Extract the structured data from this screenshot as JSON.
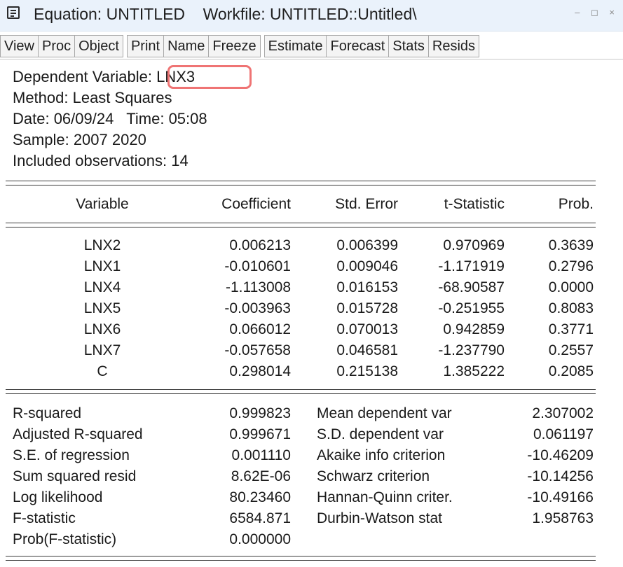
{
  "window": {
    "title": "Equation: UNTITLED    Workfile: UNTITLED::Untitled\\",
    "controls": "– ◻ ×"
  },
  "toolbar": {
    "groups": [
      [
        "View",
        "Proc",
        "Object"
      ],
      [
        "Print",
        "Name",
        "Freeze"
      ],
      [
        "Estimate",
        "Forecast",
        "Stats",
        "Resids"
      ]
    ]
  },
  "header": {
    "dependent_variable": "Dependent Variable: LNX3",
    "method": "Method: Least Squares",
    "date_time": "Date: 06/09/24   Time: 05:08",
    "sample": "Sample: 2007 2020",
    "observations": "Included observations: 14"
  },
  "coef_table": {
    "columns": [
      "Variable",
      "Coefficient",
      "Std. Error",
      "t-Statistic",
      "Prob."
    ],
    "rows": [
      [
        "LNX2",
        "0.006213",
        "0.006399",
        "0.970969",
        "0.3639"
      ],
      [
        "LNX1",
        "-0.010601",
        "0.009046",
        "-1.171919",
        "0.2796"
      ],
      [
        "LNX4",
        "-1.113008",
        "0.016153",
        "-68.90587",
        "0.0000"
      ],
      [
        "LNX5",
        "-0.003963",
        "0.015728",
        "-0.251955",
        "0.8083"
      ],
      [
        "LNX6",
        "0.066012",
        "0.070013",
        "0.942859",
        "0.3771"
      ],
      [
        "LNX7",
        "-0.057658",
        "0.046581",
        "-1.237790",
        "0.2557"
      ],
      [
        "C",
        "0.298014",
        "0.215138",
        "1.385222",
        "0.2085"
      ]
    ]
  },
  "stats": {
    "left": [
      [
        "R-squared",
        "0.999823"
      ],
      [
        "Adjusted R-squared",
        "0.999671"
      ],
      [
        "S.E. of regression",
        "0.001110"
      ],
      [
        "Sum squared resid",
        "8.62E-06"
      ],
      [
        "Log likelihood",
        "80.23460"
      ],
      [
        "F-statistic",
        "6584.871"
      ],
      [
        "Prob(F-statistic)",
        "0.000000"
      ]
    ],
    "right": [
      [
        "Mean dependent var",
        "2.307002"
      ],
      [
        "S.D. dependent var",
        "0.061197"
      ],
      [
        "Akaike info criterion",
        "-10.46209"
      ],
      [
        "Schwarz criterion",
        "-10.14256"
      ],
      [
        "Hannan-Quinn criter.",
        "-10.49166"
      ],
      [
        "Durbin-Watson stat",
        "1.958763"
      ]
    ]
  },
  "colors": {
    "highlight": "#ef7474",
    "titlebar": "#eaf2fb"
  }
}
